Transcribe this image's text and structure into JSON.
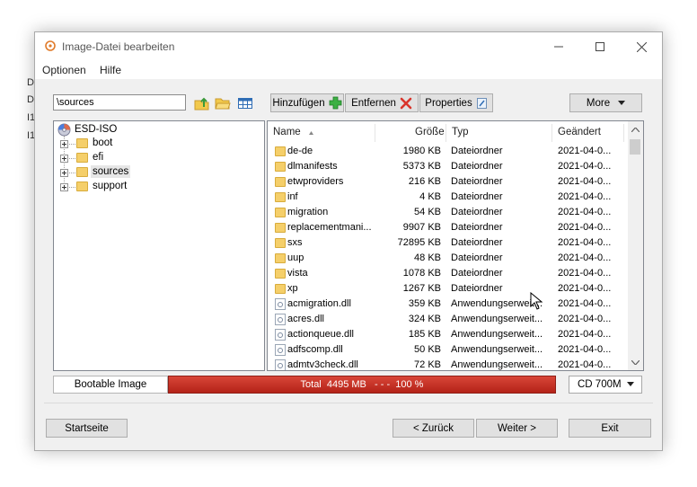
{
  "window": {
    "title": "Image-Datei bearbeiten",
    "menu": [
      "Optionen",
      "Hilfe"
    ]
  },
  "toolbar": {
    "path": "\\sources",
    "add_label": "Hinzufügen",
    "remove_label": "Entfernen",
    "properties_label": "Properties",
    "more_label": "More"
  },
  "tree": {
    "root": "ESD-ISO",
    "children": [
      "boot",
      "efi",
      "sources",
      "support"
    ]
  },
  "list": {
    "columns": {
      "name": "Name",
      "size": "Größe",
      "type": "Typ",
      "modified": "Geändert"
    },
    "rows": [
      {
        "kind": "folder",
        "name": "de-de",
        "size": "1980 KB",
        "type": "Dateiordner",
        "modified": "2021-04-0..."
      },
      {
        "kind": "folder",
        "name": "dlmanifests",
        "size": "5373 KB",
        "type": "Dateiordner",
        "modified": "2021-04-0..."
      },
      {
        "kind": "folder",
        "name": "etwproviders",
        "size": "216 KB",
        "type": "Dateiordner",
        "modified": "2021-04-0..."
      },
      {
        "kind": "folder",
        "name": "inf",
        "size": "4 KB",
        "type": "Dateiordner",
        "modified": "2021-04-0..."
      },
      {
        "kind": "folder",
        "name": "migration",
        "size": "54 KB",
        "type": "Dateiordner",
        "modified": "2021-04-0..."
      },
      {
        "kind": "folder",
        "name": "replacementmani...",
        "size": "9907 KB",
        "type": "Dateiordner",
        "modified": "2021-04-0..."
      },
      {
        "kind": "folder",
        "name": "sxs",
        "size": "72895 KB",
        "type": "Dateiordner",
        "modified": "2021-04-0..."
      },
      {
        "kind": "folder",
        "name": "uup",
        "size": "48 KB",
        "type": "Dateiordner",
        "modified": "2021-04-0..."
      },
      {
        "kind": "folder",
        "name": "vista",
        "size": "1078 KB",
        "type": "Dateiordner",
        "modified": "2021-04-0..."
      },
      {
        "kind": "folder",
        "name": "xp",
        "size": "1267 KB",
        "type": "Dateiordner",
        "modified": "2021-04-0..."
      },
      {
        "kind": "file",
        "name": "acmigration.dll",
        "size": "359 KB",
        "type": "Anwendungserweit...",
        "modified": "2021-04-0..."
      },
      {
        "kind": "file",
        "name": "acres.dll",
        "size": "324 KB",
        "type": "Anwendungserweit...",
        "modified": "2021-04-0..."
      },
      {
        "kind": "file",
        "name": "actionqueue.dll",
        "size": "185 KB",
        "type": "Anwendungserweit...",
        "modified": "2021-04-0..."
      },
      {
        "kind": "file",
        "name": "adfscomp.dll",
        "size": "50 KB",
        "type": "Anwendungserweit...",
        "modified": "2021-04-0..."
      },
      {
        "kind": "file",
        "name": "admtv3check.dll",
        "size": "72 KB",
        "type": "Anwendungserweit...",
        "modified": "2021-04-0..."
      }
    ]
  },
  "status": {
    "bootable_label": "Bootable Image",
    "capacity_text": "Total  4495 MB   - - -  100 %",
    "capacity_fraction": 1.0,
    "media": "CD 700M"
  },
  "footer": {
    "home_label": "Startseite",
    "back_label": "< Zurück",
    "next_label": "Weiter >",
    "exit_label": "Exit"
  },
  "colors": {
    "capacity_bar": "#c0392b",
    "folder": "#f5cf6a",
    "add_icon": "#3cb043",
    "remove_icon": "#d9342b"
  },
  "icons": [
    "app-icon",
    "upload-folder-icon",
    "open-folder-icon",
    "view-grid-icon",
    "plus-icon",
    "delete-x-icon",
    "properties-icon",
    "disc-icon",
    "folder-icon",
    "dll-file-icon"
  ]
}
